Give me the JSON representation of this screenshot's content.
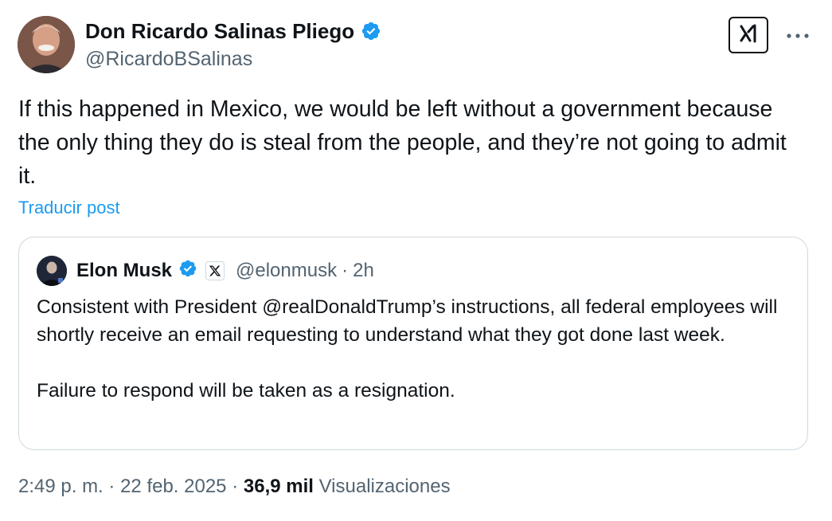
{
  "post": {
    "author_name": "Don Ricardo Salinas Pliego",
    "author_handle": "@RicardoBSalinas",
    "text": "If this happened in Mexico, we would be left without a government because the only thing they do is steal from the people, and they’re not going to admit it.",
    "translate_label": "Traducir post",
    "time": "2:49 p. m.",
    "date": "22 feb. 2025",
    "separator": "·",
    "views_count": "36,9 mil",
    "views_label": "Visualizaciones"
  },
  "quote": {
    "author_name": "Elon Musk",
    "author_handle": "@elonmusk",
    "separator": "·",
    "time": "2h",
    "paragraphs": [
      "Consistent with President @realDonaldTrump’s instructions, all federal employees will shortly receive an email requesting to understand what they got done last week.",
      "Failure to respond will be taken as a resignation."
    ]
  },
  "colors": {
    "accent": "#1d9bf0",
    "text_primary": "#0f1419",
    "text_secondary": "#536471",
    "border": "#cfd9de"
  },
  "icons": {
    "verified": "verified-badge-icon",
    "grok": "grok-icon",
    "more": "more-options-icon",
    "x_affiliate": "x-logo-icon"
  }
}
